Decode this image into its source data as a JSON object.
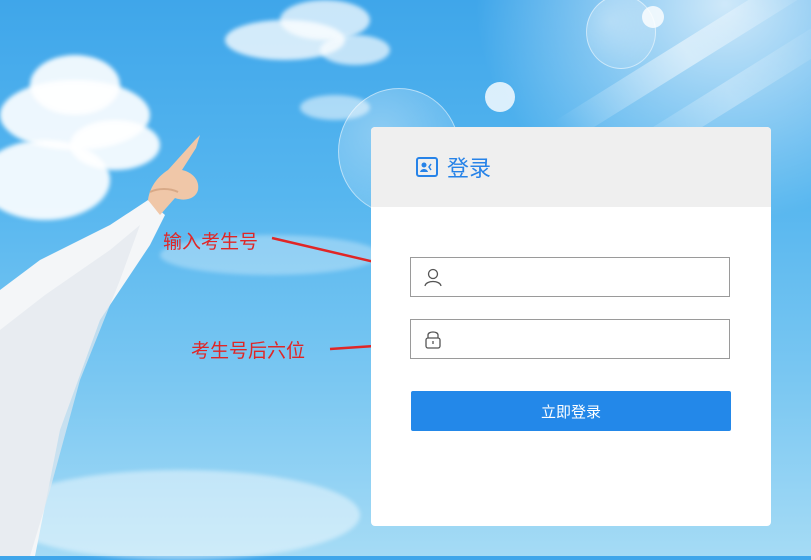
{
  "login": {
    "title": "登录",
    "username": {
      "value": "",
      "placeholder": "",
      "icon": "user-icon"
    },
    "password": {
      "value": "",
      "placeholder": "",
      "icon": "lock-icon"
    },
    "submit_label": "立即登录"
  },
  "annotations": {
    "username_hint": "输入考生号",
    "password_hint": "考生号后六位"
  },
  "colors": {
    "accent": "#2388e9",
    "title": "#2783e8",
    "annotation": "#e02626",
    "header_bg": "#efefef"
  }
}
